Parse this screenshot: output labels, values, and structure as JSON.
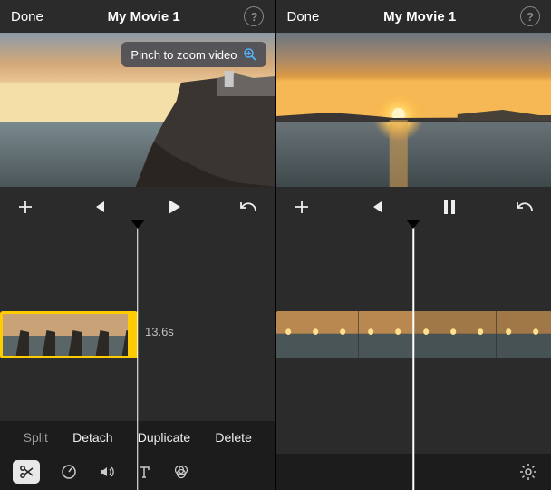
{
  "left": {
    "done": "Done",
    "title": "My Movie 1",
    "tooltip": "Pinch to zoom video",
    "duration": "13.6s",
    "actions": {
      "split": "Split",
      "detach": "Detach",
      "duplicate": "Duplicate",
      "delete": "Delete"
    }
  },
  "right": {
    "done": "Done",
    "title": "My Movie 1"
  }
}
